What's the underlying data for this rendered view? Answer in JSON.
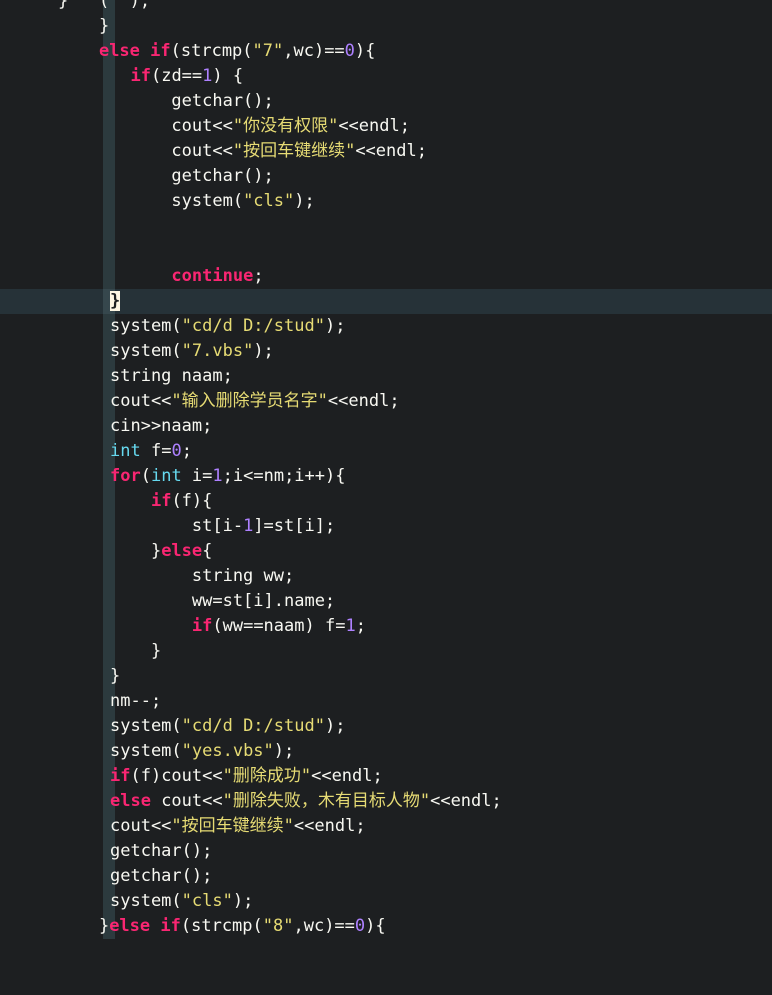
{
  "editor": {
    "language": "C++",
    "theme_name": "monokai-dark",
    "colors": {
      "background": "#1d1f21",
      "active_line": "#263238",
      "indent_guide": "#2c3a3e",
      "keyword": "#f92672",
      "type": "#66d9ef",
      "number": "#ae81ff",
      "string": "#e6db74",
      "plain": "#f8f8f2",
      "bracket_match_bg": "#fdf6e3",
      "bracket_match_fg": "#1d1f21"
    },
    "active_line_index": 12,
    "bracket_match_char": "}"
  },
  "lines": [
    {
      "indent": 0,
      "clipped": true,
      "tokens": [
        {
          "t": "}",
          "c": "pln"
        },
        {
          "t": "   (",
          "c": "pln"
        },
        {
          "t": "  );",
          "c": "pln"
        }
      ]
    },
    {
      "indent": 0,
      "tokens": [
        {
          "t": "    }",
          "c": "pln"
        }
      ]
    },
    {
      "indent": 0,
      "tokens": [
        {
          "t": "    ",
          "c": "pln"
        },
        {
          "t": "else",
          "c": "kw"
        },
        {
          "t": " ",
          "c": "pln"
        },
        {
          "t": "if",
          "c": "kw"
        },
        {
          "t": "(strcmp(",
          "c": "pln"
        },
        {
          "t": "\"7\"",
          "c": "str"
        },
        {
          "t": ",wc)==",
          "c": "pln"
        },
        {
          "t": "0",
          "c": "num"
        },
        {
          "t": "){",
          "c": "pln"
        }
      ]
    },
    {
      "indent": 1,
      "tokens": [
        {
          "t": "  ",
          "c": "pln"
        },
        {
          "t": "if",
          "c": "kw"
        },
        {
          "t": "(zd==",
          "c": "pln"
        },
        {
          "t": "1",
          "c": "num"
        },
        {
          "t": ") {",
          "c": "pln"
        }
      ]
    },
    {
      "indent": 1,
      "tokens": [
        {
          "t": "      getchar();",
          "c": "pln"
        }
      ]
    },
    {
      "indent": 1,
      "tokens": [
        {
          "t": "      cout<<",
          "c": "pln"
        },
        {
          "t": "\"你没有权限\"",
          "c": "str"
        },
        {
          "t": "<<endl;",
          "c": "pln"
        }
      ]
    },
    {
      "indent": 1,
      "tokens": [
        {
          "t": "      cout<<",
          "c": "pln"
        },
        {
          "t": "\"按回车键继续\"",
          "c": "str"
        },
        {
          "t": "<<endl;",
          "c": "pln"
        }
      ]
    },
    {
      "indent": 1,
      "tokens": [
        {
          "t": "      getchar();",
          "c": "pln"
        }
      ]
    },
    {
      "indent": 1,
      "tokens": [
        {
          "t": "      system(",
          "c": "pln"
        },
        {
          "t": "\"cls\"",
          "c": "str"
        },
        {
          "t": ");",
          "c": "pln"
        }
      ]
    },
    {
      "indent": 1,
      "tokens": []
    },
    {
      "indent": 1,
      "tokens": []
    },
    {
      "indent": 1,
      "tokens": [
        {
          "t": "      ",
          "c": "pln"
        },
        {
          "t": "continue",
          "c": "kw"
        },
        {
          "t": ";",
          "c": "pln"
        }
      ]
    },
    {
      "indent": 1,
      "active": true,
      "tokens": [
        {
          "t": "}",
          "c": "brk-hl"
        }
      ]
    },
    {
      "indent": 1,
      "tokens": [
        {
          "t": "system(",
          "c": "pln"
        },
        {
          "t": "\"cd/d D:/stud\"",
          "c": "str"
        },
        {
          "t": ");",
          "c": "pln"
        }
      ]
    },
    {
      "indent": 1,
      "tokens": [
        {
          "t": "system(",
          "c": "pln"
        },
        {
          "t": "\"7.vbs\"",
          "c": "str"
        },
        {
          "t": ");",
          "c": "pln"
        }
      ]
    },
    {
      "indent": 1,
      "tokens": [
        {
          "t": "string naam;",
          "c": "pln"
        }
      ]
    },
    {
      "indent": 1,
      "tokens": [
        {
          "t": "cout<<",
          "c": "pln"
        },
        {
          "t": "\"输入删除学员名字\"",
          "c": "str"
        },
        {
          "t": "<<endl;",
          "c": "pln"
        }
      ]
    },
    {
      "indent": 1,
      "tokens": [
        {
          "t": "cin>>naam;",
          "c": "pln"
        }
      ]
    },
    {
      "indent": 1,
      "tokens": [
        {
          "t": "int",
          "c": "typ"
        },
        {
          "t": " f=",
          "c": "pln"
        },
        {
          "t": "0",
          "c": "num"
        },
        {
          "t": ";",
          "c": "pln"
        }
      ]
    },
    {
      "indent": 1,
      "tokens": [
        {
          "t": "for",
          "c": "kw"
        },
        {
          "t": "(",
          "c": "pln"
        },
        {
          "t": "int",
          "c": "typ"
        },
        {
          "t": " i=",
          "c": "pln"
        },
        {
          "t": "1",
          "c": "num"
        },
        {
          "t": ";i<=nm;i++){",
          "c": "pln"
        }
      ]
    },
    {
      "indent": 1,
      "tokens": [
        {
          "t": "    ",
          "c": "pln"
        },
        {
          "t": "if",
          "c": "kw"
        },
        {
          "t": "(f){",
          "c": "pln"
        }
      ]
    },
    {
      "indent": 1,
      "tokens": [
        {
          "t": "        st[i-",
          "c": "pln"
        },
        {
          "t": "1",
          "c": "num"
        },
        {
          "t": "]=st[i];",
          "c": "pln"
        }
      ]
    },
    {
      "indent": 1,
      "tokens": [
        {
          "t": "    }",
          "c": "pln"
        },
        {
          "t": "else",
          "c": "kw"
        },
        {
          "t": "{",
          "c": "pln"
        }
      ]
    },
    {
      "indent": 1,
      "tokens": [
        {
          "t": "        string ww;",
          "c": "pln"
        }
      ]
    },
    {
      "indent": 1,
      "tokens": [
        {
          "t": "        ww=st[i].name;",
          "c": "pln"
        }
      ]
    },
    {
      "indent": 1,
      "tokens": [
        {
          "t": "        ",
          "c": "pln"
        },
        {
          "t": "if",
          "c": "kw"
        },
        {
          "t": "(ww==naam) f=",
          "c": "pln"
        },
        {
          "t": "1",
          "c": "num"
        },
        {
          "t": ";",
          "c": "pln"
        }
      ]
    },
    {
      "indent": 1,
      "tokens": [
        {
          "t": "    }",
          "c": "pln"
        }
      ]
    },
    {
      "indent": 1,
      "tokens": [
        {
          "t": "}",
          "c": "pln"
        }
      ]
    },
    {
      "indent": 1,
      "tokens": [
        {
          "t": "nm--;",
          "c": "pln"
        }
      ]
    },
    {
      "indent": 1,
      "tokens": [
        {
          "t": "system(",
          "c": "pln"
        },
        {
          "t": "\"cd/d D:/stud\"",
          "c": "str"
        },
        {
          "t": ");",
          "c": "pln"
        }
      ]
    },
    {
      "indent": 1,
      "tokens": [
        {
          "t": "system(",
          "c": "pln"
        },
        {
          "t": "\"yes.vbs\"",
          "c": "str"
        },
        {
          "t": ");",
          "c": "pln"
        }
      ]
    },
    {
      "indent": 1,
      "tokens": [
        {
          "t": "if",
          "c": "kw"
        },
        {
          "t": "(f)cout<<",
          "c": "pln"
        },
        {
          "t": "\"删除成功\"",
          "c": "str"
        },
        {
          "t": "<<endl;",
          "c": "pln"
        }
      ]
    },
    {
      "indent": 1,
      "tokens": [
        {
          "t": "else",
          "c": "kw"
        },
        {
          "t": " cout<<",
          "c": "pln"
        },
        {
          "t": "\"删除失败，木有目标人物\"",
          "c": "str"
        },
        {
          "t": "<<endl;",
          "c": "pln"
        }
      ]
    },
    {
      "indent": 1,
      "tokens": [
        {
          "t": "cout<<",
          "c": "pln"
        },
        {
          "t": "\"按回车键继续\"",
          "c": "str"
        },
        {
          "t": "<<endl;",
          "c": "pln"
        }
      ]
    },
    {
      "indent": 1,
      "tokens": [
        {
          "t": "getchar();",
          "c": "pln"
        }
      ]
    },
    {
      "indent": 1,
      "tokens": [
        {
          "t": "getchar();",
          "c": "pln"
        }
      ]
    },
    {
      "indent": 1,
      "tokens": [
        {
          "t": "system(",
          "c": "pln"
        },
        {
          "t": "\"cls\"",
          "c": "str"
        },
        {
          "t": ");",
          "c": "pln"
        }
      ]
    },
    {
      "indent": 0,
      "clipped_bottom": true,
      "tokens": [
        {
          "t": "    }",
          "c": "pln"
        },
        {
          "t": "else",
          "c": "kw"
        },
        {
          "t": " ",
          "c": "pln"
        },
        {
          "t": "if",
          "c": "kw"
        },
        {
          "t": "(strcmp(",
          "c": "pln"
        },
        {
          "t": "\"8\"",
          "c": "str"
        },
        {
          "t": ",wc)==",
          "c": "pln"
        },
        {
          "t": "0",
          "c": "num"
        },
        {
          "t": "){",
          "c": "pln"
        }
      ]
    }
  ]
}
